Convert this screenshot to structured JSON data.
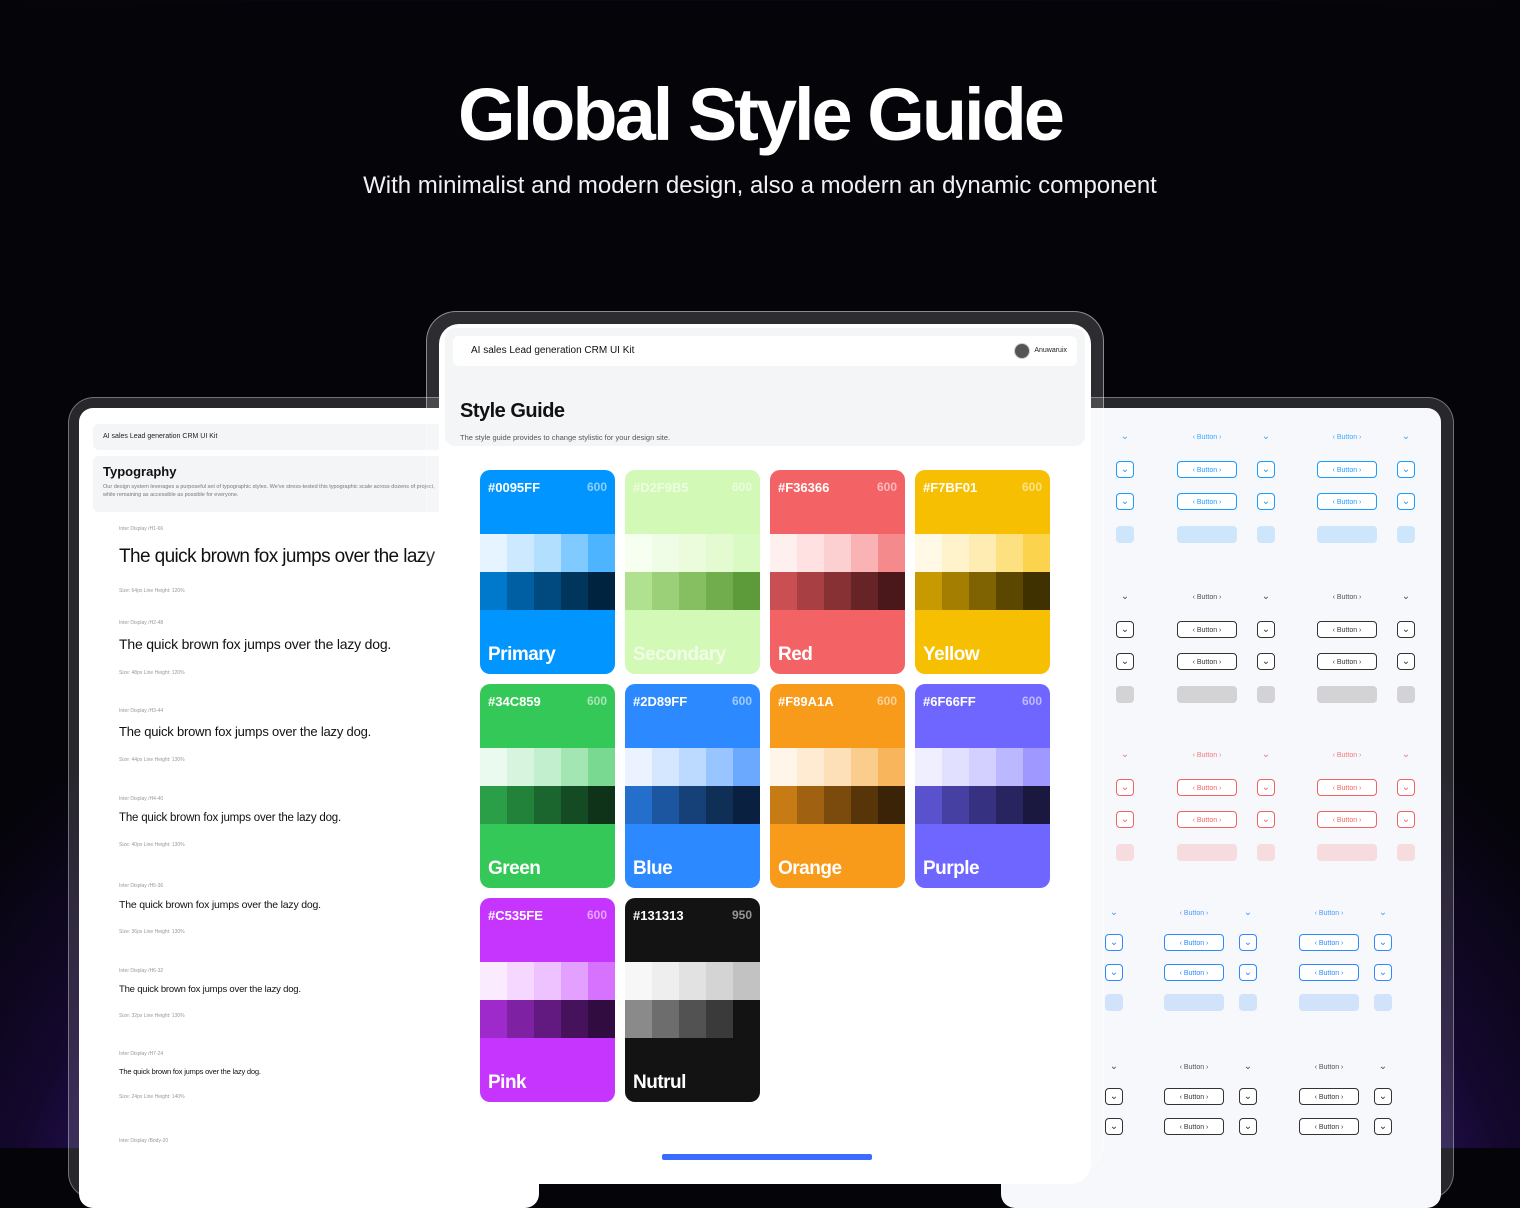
{
  "hero": {
    "title": "Global Style Guide",
    "subtitle": "With minimalist and modern design, also a modern an dynamic component"
  },
  "left_panel": {
    "kit_name": "AI sales Lead generation CRM UI Kit",
    "section_title": "Typography",
    "section_desc": "Our design system leverages a purposeful set of typographic styles. We've stress-tested this typographic scale across dozens of project, while remaining as accessible as possible for everyone.",
    "type_styles": [
      {
        "label": "Inter Display /H1-66",
        "sample": "The quick brown fox jumps over the lazy dog.",
        "meta": "Size: 64px     Line Height: 120%"
      },
      {
        "label": "Inter Display /H2-48",
        "sample": "The quick brown fox jumps over the lazy dog.",
        "meta": "Size: 48px     Line Height: 120%"
      },
      {
        "label": "Inter Display /H3-44",
        "sample": "The quick brown fox jumps over the lazy dog.",
        "meta": "Size: 44px     Line Height: 130%"
      },
      {
        "label": "Inter Display /H4-40",
        "sample": "The quick brown fox jumps over the lazy dog.",
        "meta": "Size: 40px     Line Height: 130%"
      },
      {
        "label": "Inter Display /H5-36",
        "sample": "The quick brown fox jumps over the lazy dog.",
        "meta": "Size: 36px     Line Height: 130%"
      },
      {
        "label": "Inter Display /H6-32",
        "sample": "The quick brown fox jumps over the lazy dog.",
        "meta": "Size: 32px     Line Height: 130%"
      },
      {
        "label": "Inter Display /H7-24",
        "sample": "The quick brown fox jumps over the lazy dog.",
        "meta": "Size: 24px     Line Height: 140%"
      },
      {
        "label": "Inter Display /Body-20",
        "sample": "",
        "meta": ""
      }
    ]
  },
  "center_panel": {
    "kit_name": "AI sales Lead generation CRM UI Kit",
    "user_name": "Anuwaruix",
    "title": "Style Guide",
    "subtitle": "The style guide provides to change stylistic for your design site."
  },
  "palettes": [
    {
      "hex": "#0095FF",
      "shade": "600",
      "name": "Primary",
      "base": "#0095FF",
      "light": [
        "#e6f4ff",
        "#cce9ff",
        "#b3dfff",
        "#80caff",
        "#4db5ff"
      ],
      "dark": [
        "#0078cc",
        "#005fa3",
        "#004a80",
        "#00365c",
        "#002440"
      ]
    },
    {
      "hex": "#D2F9B5",
      "shade": "600",
      "name": "Secondary",
      "base": "#D2F9B5",
      "light": [
        "#f6fff0",
        "#f0fde6",
        "#ebfcdd",
        "#e4fbd2",
        "#dafac3"
      ],
      "dark": [
        "#b0e18e",
        "#9bd078",
        "#86bf62",
        "#71ad4d",
        "#5c9a3a"
      ]
    },
    {
      "hex": "#F36366",
      "shade": "600",
      "name": "Red",
      "base": "#F36366",
      "light": [
        "#fff0f0",
        "#ffe1e2",
        "#fcd0d1",
        "#f9b3b4",
        "#f58a8c"
      ],
      "dark": [
        "#c94f52",
        "#a83f42",
        "#873134",
        "#672426",
        "#4a181a"
      ]
    },
    {
      "hex": "#F7BF01",
      "shade": "600",
      "name": "Yellow",
      "base": "#F7BF01",
      "light": [
        "#fff9e6",
        "#fff3cc",
        "#ffecb3",
        "#fde080",
        "#fbd34d"
      ],
      "dark": [
        "#c79a01",
        "#a37e01",
        "#7f6201",
        "#5c4701",
        "#3f3100"
      ]
    },
    {
      "hex": "#34C859",
      "shade": "600",
      "name": "Green",
      "base": "#34C859",
      "light": [
        "#ebfaef",
        "#d6f4de",
        "#c2efcd",
        "#a3e6b4",
        "#7ad990"
      ],
      "dark": [
        "#2a9f47",
        "#22823a",
        "#1b662e",
        "#144b22",
        "#0e3318"
      ]
    },
    {
      "hex": "#2D89FF",
      "shade": "600",
      "name": "Blue",
      "base": "#2D89FF",
      "light": [
        "#eaf3ff",
        "#d5e7ff",
        "#bcd9ff",
        "#98c5ff",
        "#6ba9ff"
      ],
      "dark": [
        "#246ecc",
        "#1c56a0",
        "#154178",
        "#0f2f57",
        "#0a2040"
      ]
    },
    {
      "hex": "#F89A1A",
      "shade": "600",
      "name": "Orange",
      "base": "#F89A1A",
      "light": [
        "#fff5e8",
        "#ffebd1",
        "#fde0b8",
        "#fbcd8d",
        "#f9b55c"
      ],
      "dark": [
        "#c77b15",
        "#a06211",
        "#7a4b0d",
        "#573509",
        "#3a2306"
      ]
    },
    {
      "hex": "#6F66FF",
      "shade": "600",
      "name": "Purple",
      "base": "#6F66FF",
      "light": [
        "#f0efff",
        "#e2e0ff",
        "#d3d0ff",
        "#bcb8ff",
        "#9e98ff"
      ],
      "dark": [
        "#5952cc",
        "#4640a3",
        "#363180",
        "#28245f",
        "#1b1840"
      ]
    },
    {
      "hex": "#C535FE",
      "shade": "600",
      "name": "Pink",
      "base": "#C535FE",
      "light": [
        "#faebff",
        "#f5d7ff",
        "#eec2ff",
        "#e3a0ff",
        "#d672fe"
      ],
      "dark": [
        "#9e2acb",
        "#7f21a3",
        "#621980",
        "#47125c",
        "#300c40"
      ]
    },
    {
      "hex": "#131313",
      "shade": "950",
      "name": "Nutrul",
      "base": "#131313",
      "light": [
        "#f7f7f7",
        "#eeeeee",
        "#e2e2e2",
        "#d4d4d4",
        "#c2c2c2"
      ],
      "dark": [
        "#8a8a8a",
        "#6d6d6d",
        "#525252",
        "#3a3a3a",
        "#131313"
      ]
    }
  ],
  "button_label": "Button",
  "colors": {
    "blue_button": "#1a9bff",
    "neutral_button": "#333333",
    "red_button": "#f36366",
    "blue_button_2": "#2d89ff"
  }
}
